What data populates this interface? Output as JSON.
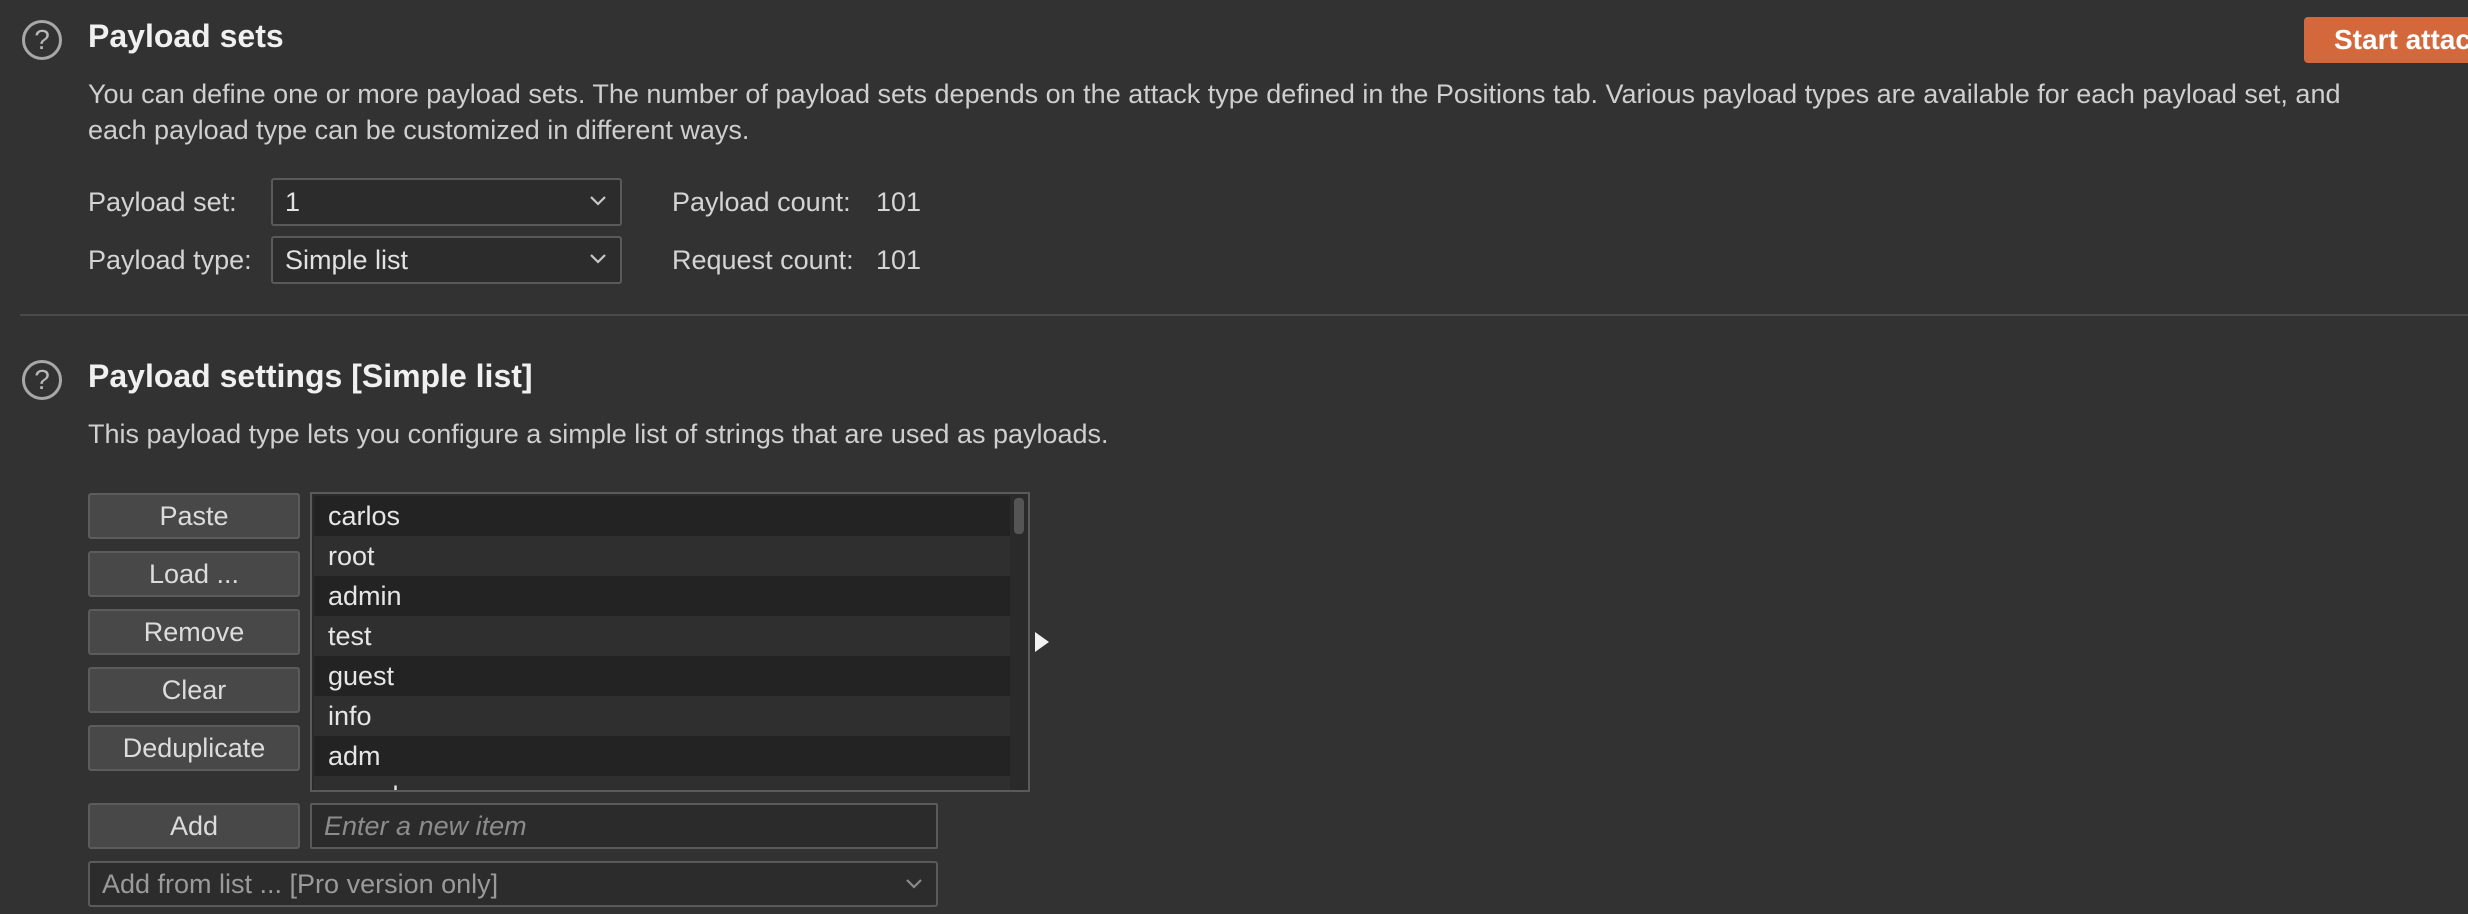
{
  "payload_sets": {
    "title": "Payload sets",
    "description_line1": "You can define one or more payload sets. The number of payload sets depends on the attack type defined in the Positions tab. Various payload types are available for each payload set, and",
    "description_line2": "each payload type can be customized in different ways.",
    "payload_set_label": "Payload set:",
    "payload_set_value": "1",
    "payload_type_label": "Payload type:",
    "payload_type_value": "Simple list",
    "payload_count_label": "Payload count:",
    "payload_count_value": "101",
    "request_count_label": "Request count:",
    "request_count_value": "101",
    "start_attack_label": "Start attack"
  },
  "payload_settings": {
    "title": "Payload settings [Simple list]",
    "description": "This payload type lets you configure a simple list of strings that are used as payloads.",
    "buttons": {
      "paste": "Paste",
      "load": "Load ...",
      "remove": "Remove",
      "clear": "Clear",
      "deduplicate": "Deduplicate",
      "add": "Add"
    },
    "items": [
      "carlos",
      "root",
      "admin",
      "test",
      "guest",
      "info",
      "adm",
      "mysql"
    ],
    "new_item_placeholder": "Enter a new item",
    "add_from_list": "Add from list ... [Pro version only]"
  },
  "icons": {
    "help": "question-circle-icon",
    "dropdown": "chevron-down-icon",
    "expand": "triangle-right-icon"
  },
  "colors": {
    "background": "#323232",
    "accent": "#d3683c"
  }
}
